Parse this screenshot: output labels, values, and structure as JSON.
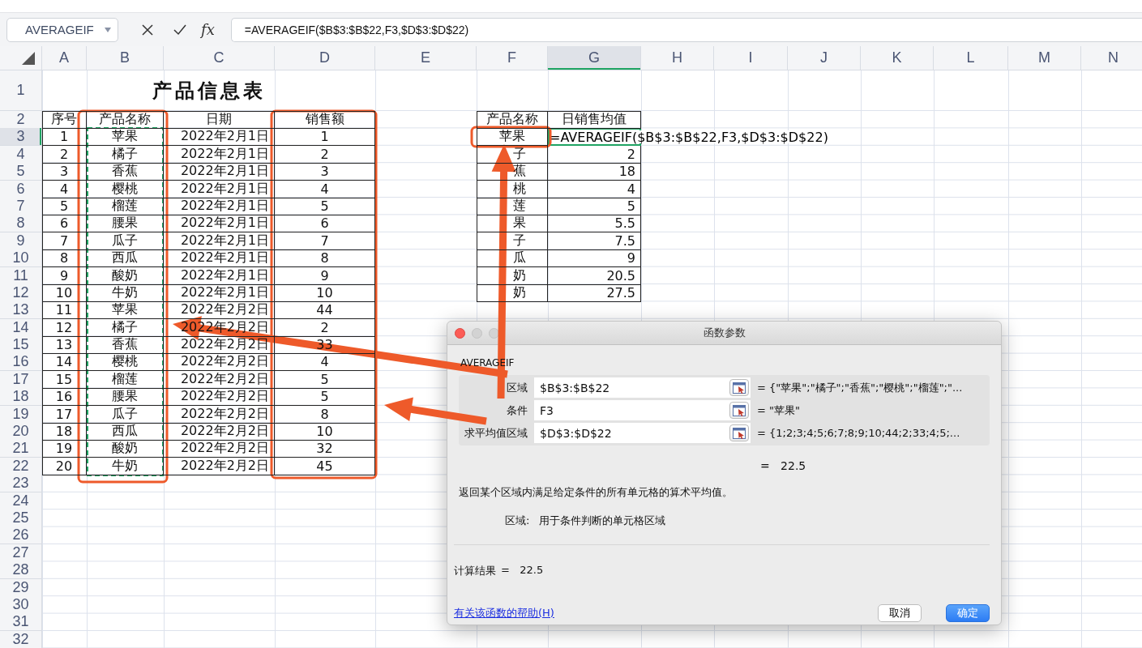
{
  "name_box": "AVERAGEIF",
  "formula_bar": {
    "fx": "fx",
    "value": "=AVERAGEIF($B$3:$B$22,F3,$D$3:$D$22)"
  },
  "columns": [
    {
      "label": "A",
      "selected": false
    },
    {
      "label": "B",
      "selected": false
    },
    {
      "label": "C",
      "selected": false
    },
    {
      "label": "D",
      "selected": false
    },
    {
      "label": "E",
      "selected": false
    },
    {
      "label": "F",
      "selected": false
    },
    {
      "label": "G",
      "selected": true
    },
    {
      "label": "H",
      "selected": false
    },
    {
      "label": "I",
      "selected": false
    },
    {
      "label": "J",
      "selected": false
    },
    {
      "label": "K",
      "selected": false
    },
    {
      "label": "L",
      "selected": false
    },
    {
      "label": "M",
      "selected": false
    },
    {
      "label": "N",
      "selected": false
    }
  ],
  "rows": [
    {
      "label": "1",
      "selected": false
    },
    {
      "label": "2",
      "selected": false
    },
    {
      "label": "3",
      "selected": true
    },
    {
      "label": "4",
      "selected": false
    },
    {
      "label": "5",
      "selected": false
    },
    {
      "label": "6",
      "selected": false
    },
    {
      "label": "7",
      "selected": false
    },
    {
      "label": "8",
      "selected": false
    },
    {
      "label": "9",
      "selected": false
    },
    {
      "label": "10",
      "selected": false
    },
    {
      "label": "11",
      "selected": false
    },
    {
      "label": "12",
      "selected": false
    },
    {
      "label": "13",
      "selected": false
    },
    {
      "label": "14",
      "selected": false
    },
    {
      "label": "15",
      "selected": false
    },
    {
      "label": "16",
      "selected": false
    },
    {
      "label": "17",
      "selected": false
    },
    {
      "label": "18",
      "selected": false
    },
    {
      "label": "19",
      "selected": false
    },
    {
      "label": "20",
      "selected": false
    },
    {
      "label": "21",
      "selected": false
    },
    {
      "label": "22",
      "selected": false
    },
    {
      "label": "23",
      "selected": false
    },
    {
      "label": "24",
      "selected": false
    },
    {
      "label": "25",
      "selected": false
    },
    {
      "label": "26",
      "selected": false
    },
    {
      "label": "27",
      "selected": false
    },
    {
      "label": "28",
      "selected": false
    },
    {
      "label": "29",
      "selected": false
    },
    {
      "label": "30",
      "selected": false
    },
    {
      "label": "31",
      "selected": false
    },
    {
      "label": "32",
      "selected": false
    }
  ],
  "title": "产品信息表",
  "table": {
    "columns": [
      "序号",
      "产品名称",
      "日期",
      "销售额"
    ],
    "rows": [
      [
        "1",
        "苹果",
        "2022年2月1日",
        "1"
      ],
      [
        "2",
        "橘子",
        "2022年2月1日",
        "2"
      ],
      [
        "3",
        "香蕉",
        "2022年2月1日",
        "3"
      ],
      [
        "4",
        "樱桃",
        "2022年2月1日",
        "4"
      ],
      [
        "5",
        "榴莲",
        "2022年2月1日",
        "5"
      ],
      [
        "6",
        "腰果",
        "2022年2月1日",
        "6"
      ],
      [
        "7",
        "瓜子",
        "2022年2月1日",
        "7"
      ],
      [
        "8",
        "西瓜",
        "2022年2月1日",
        "8"
      ],
      [
        "9",
        "酸奶",
        "2022年2月1日",
        "9"
      ],
      [
        "10",
        "牛奶",
        "2022年2月1日",
        "10"
      ],
      [
        "11",
        "苹果",
        "2022年2月2日",
        "44"
      ],
      [
        "12",
        "橘子",
        "2022年2月2日",
        "2"
      ],
      [
        "13",
        "香蕉",
        "2022年2月2日",
        "33"
      ],
      [
        "14",
        "樱桃",
        "2022年2月2日",
        "4"
      ],
      [
        "15",
        "榴莲",
        "2022年2月2日",
        "5"
      ],
      [
        "16",
        "腰果",
        "2022年2月2日",
        "5"
      ],
      [
        "17",
        "瓜子",
        "2022年2月2日",
        "8"
      ],
      [
        "18",
        "西瓜",
        "2022年2月2日",
        "10"
      ],
      [
        "19",
        "酸奶",
        "2022年2月2日",
        "32"
      ],
      [
        "20",
        "牛奶",
        "2022年2月2日",
        "45"
      ]
    ]
  },
  "summary": {
    "columns": [
      "产品名称",
      "日销售均值"
    ],
    "rows": [
      [
        "苹果",
        "=AVERAGEIF($B$3:$B$22,F3,$D$3:$D$22)"
      ],
      [
        "子",
        "2"
      ],
      [
        "蕉",
        "18"
      ],
      [
        "桃",
        "4"
      ],
      [
        "莲",
        "5"
      ],
      [
        "果",
        "5.5"
      ],
      [
        "子",
        "7.5"
      ],
      [
        "瓜",
        "9"
      ],
      [
        "奶",
        "20.5"
      ],
      [
        "奶",
        "27.5"
      ]
    ]
  },
  "dialog": {
    "title": "函数参数",
    "function": "AVERAGEIF",
    "params": [
      {
        "label": "区域",
        "value": "$B$3:$B$22",
        "result": "= {\"苹果\";\"橘子\";\"香蕉\";\"樱桃\";\"榴莲\";\"..."
      },
      {
        "label": "条件",
        "value": "F3",
        "result": "= \"苹果\""
      },
      {
        "label": "求平均值区域",
        "value": "$D$3:$D$22",
        "result": "= {1;2;3;4;5;6;7;8;9;10;44;2;33;4;5;..."
      }
    ],
    "result": "=   22.5",
    "description": "返回某个区域内满足给定条件的所有单元格的算术平均值。",
    "arg_help": {
      "label": "区域:",
      "text": "用于条件判断的单元格区域"
    },
    "computed": {
      "label": "计算结果",
      "value": "=   22.5"
    },
    "help_link": "有关该函数的帮助(H)",
    "buttons": [
      {
        "label": "取消",
        "primary": false
      },
      {
        "label": "确定",
        "primary": true
      }
    ]
  }
}
